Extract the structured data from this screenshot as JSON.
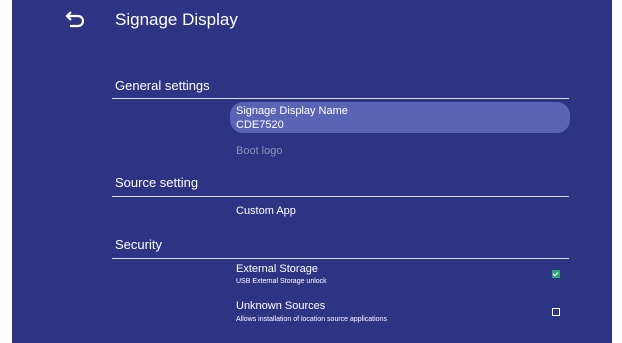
{
  "header": {
    "title": "Signage Display",
    "back_icon": "back-arrow-icon"
  },
  "sections": {
    "general": {
      "label": "General settings"
    },
    "source": {
      "label": "Source setting"
    },
    "security": {
      "label": "Security"
    }
  },
  "items": {
    "signage_name": {
      "title": "Signage Display Name",
      "value": "CDE7520",
      "selected": true
    },
    "boot_logo": {
      "title": "Boot logo",
      "enabled": false
    },
    "custom_app": {
      "title": "Custom App"
    },
    "external_storage": {
      "title": "External Storage",
      "description": "USB External Storage unlock",
      "checked": true
    },
    "unknown_sources": {
      "title": "Unknown Sources",
      "description": "Allows installation of location source applications",
      "checked": false
    }
  },
  "colors": {
    "background": "#2d3484",
    "selected_item": "#5a64b4",
    "checkbox_checked": "#35a57a",
    "disabled_text": "#9095b6"
  }
}
